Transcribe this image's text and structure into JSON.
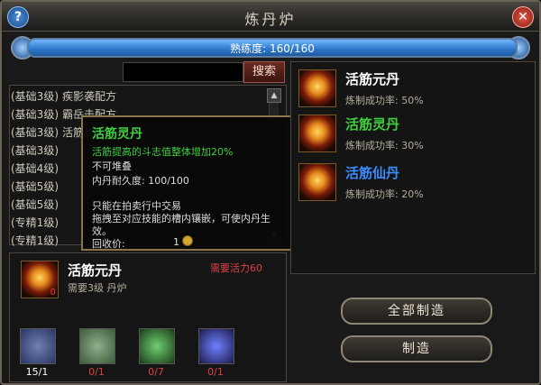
{
  "window": {
    "title": "炼丹炉",
    "help_icon": "question-icon",
    "close_icon": "close-icon"
  },
  "proficiency": {
    "label": "熟练度: 160/160",
    "fraction": 1.0
  },
  "search": {
    "placeholder": "",
    "button": "搜索"
  },
  "list": {
    "items": [
      {
        "level": "(基础3级)",
        "name": "疾影袭配方"
      },
      {
        "level": "(基础3级)",
        "name": "霸岳击配方"
      },
      {
        "level": "(基础3级)",
        "name": "活筋灵丹配方"
      },
      {
        "level": "(基础3级)",
        "name": ""
      },
      {
        "level": "(基础4级)",
        "name": ""
      },
      {
        "level": "(基础5级)",
        "name": ""
      },
      {
        "level": "(基础5级)",
        "name": ""
      },
      {
        "level": "(专精1级)",
        "name": ""
      },
      {
        "level": "(专精1级)",
        "name": ""
      }
    ]
  },
  "tooltip": {
    "name": "活筋灵丹",
    "desc": "活筋提高的斗志值整体增加20%",
    "stack": "不可堆叠",
    "durability": "内丹耐久度: 100/100",
    "trade": "只能在拍卖行中交易",
    "usage": "拖拽至对应技能的槽内镶嵌，可使内丹生效。",
    "recycle_label": "回收价:",
    "recycle_value": "1"
  },
  "recipes": [
    {
      "name": "活筋元丹",
      "rate": "炼制成功率: 50%",
      "color": "#ffffff"
    },
    {
      "name": "活筋灵丹",
      "rate": "炼制成功率: 30%",
      "color": "#3fcf3f"
    },
    {
      "name": "活筋仙丹",
      "rate": "炼制成功率: 20%",
      "color": "#3a8cff"
    }
  ],
  "selected": {
    "name": "活筋元丹",
    "need": "需要活力60",
    "furnace": "需要3级 丹炉",
    "qty": "0"
  },
  "materials": [
    {
      "icon": "vase-icon",
      "count": "15/1",
      "ok": true
    },
    {
      "icon": "jade-vase-icon",
      "count": "0/1",
      "ok": false
    },
    {
      "icon": "feather-icon",
      "count": "0/7",
      "ok": false
    },
    {
      "icon": "flower-icon",
      "count": "0/1",
      "ok": false
    }
  ],
  "buttons": {
    "all": "全部制造",
    "make": "制造"
  },
  "colors": {
    "accent_blue": "#4a9bff",
    "red_text": "#e04040",
    "gold_border": "#8a7448"
  }
}
